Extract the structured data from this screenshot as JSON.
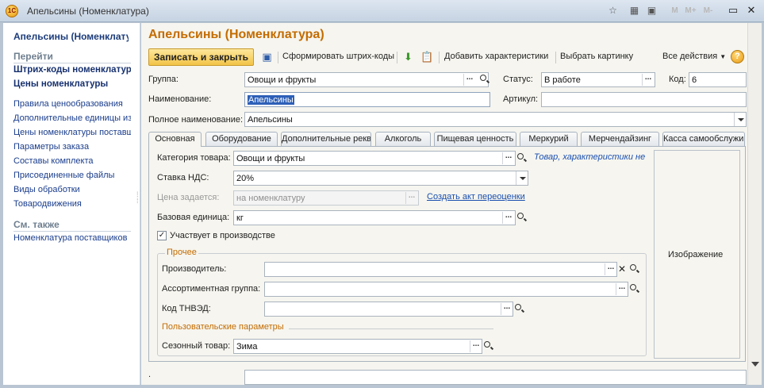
{
  "window": {
    "title": "Апельсины (Номенклатура)",
    "app_logo_text": "1С",
    "faded_icons": [
      "M",
      "M+",
      "M-"
    ]
  },
  "left_panel": {
    "title": "Апельсины (Номенклатура)",
    "goto_header": "Перейти",
    "bold_links": [
      "Штрих-коды номенклатуры",
      "Цены номенклатуры"
    ],
    "links": [
      "Правила ценообразования",
      "Дополнительные единицы измерения",
      "Цены номенклатуры поставщиков",
      "Параметры заказа",
      "Составы комплекта",
      "Присоединенные файлы",
      "Виды обработки",
      "Товародвижения"
    ],
    "see_also_header": "См. также",
    "see_also_links": [
      "Номенклатура поставщиков"
    ]
  },
  "form": {
    "title": "Апельсины (Номенклатура)",
    "toolbar": {
      "save_close": "Записать и закрыть",
      "generate_barcodes": "Сформировать штрих-коды",
      "add_characteristics": "Добавить характеристики",
      "choose_picture": "Выбрать картинку",
      "all_actions": "Все действия",
      "help": "?"
    },
    "group_label": "Группа:",
    "group_value": "Овощи и фрукты",
    "status_label": "Статус:",
    "status_value": "В работе",
    "code_label": "Код:",
    "code_value": "6",
    "name_label": "Наименование:",
    "name_value": "Апельсины",
    "article_label": "Артикул:",
    "article_value": "",
    "fullname_label": "Полное наименование:",
    "fullname_value": "Апельсины",
    "tabs": [
      "Основная",
      "Оборудование",
      "Дополнительные реквизиты",
      "Алкоголь",
      "Пищевая ценность",
      "Меркурий",
      "Мерчендайзинг",
      "Касса самообслуживания"
    ],
    "main_tab": {
      "category_label": "Категория товара:",
      "category_value": "Овощи и фрукты",
      "category_link": "Товар, характеристики не используются",
      "vat_label": "Ставка НДС:",
      "vat_value": "20%",
      "price_label": "Цена задается:",
      "price_value": "на номенклатуру",
      "price_link": "Создать акт переоценки",
      "unit_label": "Базовая единица:",
      "unit_value": "кг",
      "production_label": "Участвует в производстве",
      "production_checked": "✓",
      "other_group": "Прочее",
      "manufacturer_label": "Производитель:",
      "manufacturer_value": "",
      "assortment_label": "Ассортиментная группа:",
      "assortment_value": "",
      "tnved_label": "Код ТНВЭД:",
      "tnved_value": "",
      "user_params": "Пользовательские параметры",
      "seasonal_label": "Сезонный товар:",
      "seasonal_value": "Зима",
      "image_label": "Изображение"
    }
  }
}
